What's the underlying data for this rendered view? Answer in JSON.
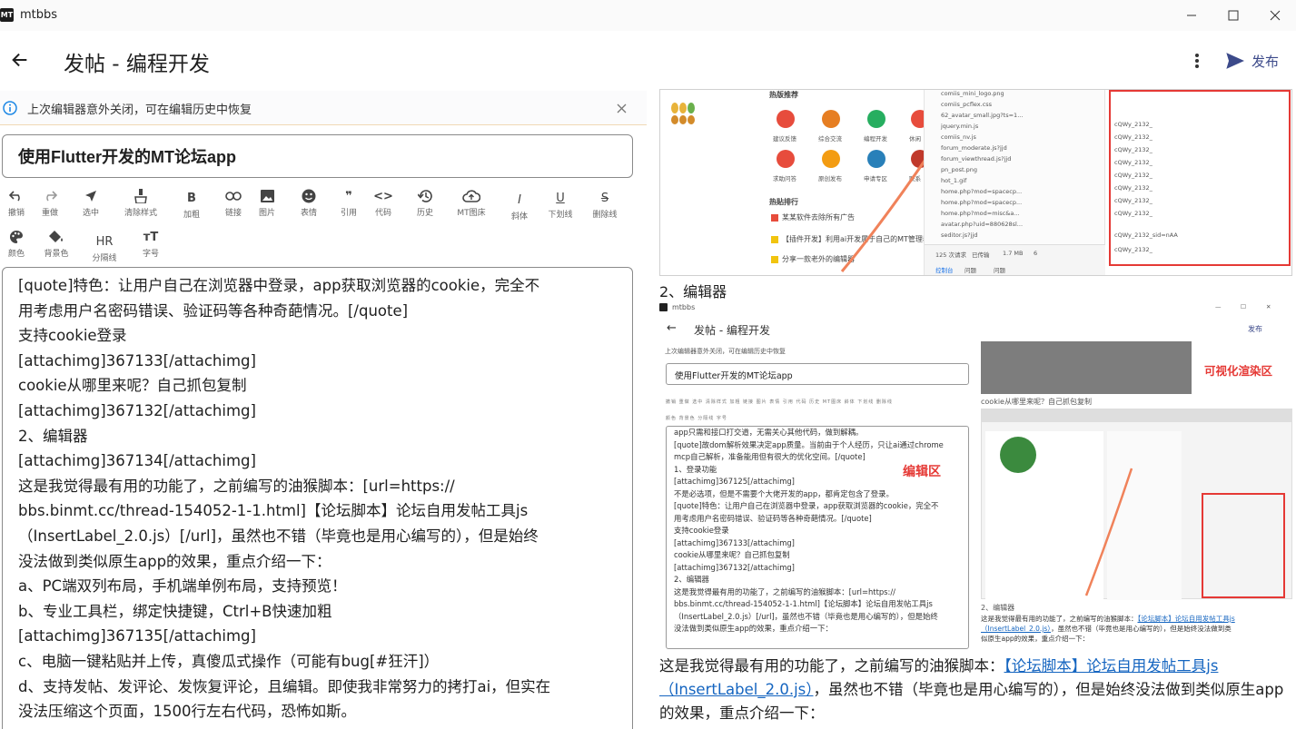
{
  "window": {
    "title": "mtbbs",
    "logo": "MT"
  },
  "appbar": {
    "title": "发帖 - 编程开发",
    "publish_label": "发布"
  },
  "notice": {
    "text": "上次编辑器意外关闭，可在编辑历史中恢复"
  },
  "title_input": {
    "value": "使用Flutter开发的MT论坛app"
  },
  "toolbar": {
    "row1": [
      {
        "id": "undo",
        "label": "撤销",
        "icon": "undo-icon"
      },
      {
        "id": "redo",
        "label": "重做",
        "icon": "redo-icon"
      },
      {
        "id": "select",
        "label": "选中",
        "icon": "cursor-icon"
      },
      {
        "id": "clear-format",
        "label": "清除样式",
        "icon": "brush-icon"
      },
      {
        "id": "bold",
        "label": "加粗",
        "icon": "bold-icon",
        "glyph": "B"
      },
      {
        "id": "link",
        "label": "链接",
        "icon": "link-icon"
      },
      {
        "id": "image",
        "label": "图片",
        "icon": "image-icon"
      },
      {
        "id": "emoji",
        "label": "表情",
        "icon": "emoji-icon"
      },
      {
        "id": "quote",
        "label": "引用",
        "icon": "quote-icon",
        "glyph": "❞"
      },
      {
        "id": "code",
        "label": "代码",
        "icon": "code-icon",
        "glyph": "<>"
      },
      {
        "id": "history",
        "label": "历史",
        "icon": "history-icon"
      },
      {
        "id": "mt-cloud",
        "label": "MT图床",
        "icon": "cloud-upload-icon"
      },
      {
        "id": "italic",
        "label": "斜体",
        "icon": "italic-icon",
        "glyph": "I"
      },
      {
        "id": "underline",
        "label": "下划线",
        "icon": "underline-icon",
        "glyph": "U"
      },
      {
        "id": "strike",
        "label": "删除线",
        "icon": "strikethrough-icon",
        "glyph": "S"
      }
    ],
    "row2": [
      {
        "id": "color",
        "label": "颜色",
        "icon": "palette-icon"
      },
      {
        "id": "bg-color",
        "label": "背景色",
        "icon": "paint-bucket-icon"
      },
      {
        "id": "hr",
        "label": "分隔线",
        "icon": "hr-icon",
        "glyph": "HR"
      },
      {
        "id": "font-size",
        "label": "字号",
        "icon": "font-size-icon",
        "glyph": "ᴛT"
      }
    ]
  },
  "editor": {
    "lines": [
      "[quote]特色：让用户自己在浏览器中登录，app获取浏览器的cookie，完全不",
      "用考虑用户名密码错误、验证码等各种奇葩情况。[/quote]",
      "支持cookie登录",
      "[attachimg]367133[/attachimg]",
      "cookie从哪里来呢？自己抓包复制",
      "[attachimg]367132[/attachimg]",
      "2、编辑器",
      "[attachimg]367134[/attachimg]",
      "这是我觉得最有用的功能了，之前编写的油猴脚本：[url=https://",
      "bbs.binmt.cc/thread-154052-1-1.html]【论坛脚本】论坛自用发帖工具js",
      "（InsertLabel_2.0.js）[/url]，虽然也不错（毕竟也是用心编写的），但是始终",
      "没法做到类似原生app的效果，重点介绍一下：",
      "a、PC端双列布局，手机端单例布局，支持预览！",
      "b、专业工具栏，绑定快捷键，Ctrl+B快速加粗",
      "[attachimg]367135[/attachimg]",
      "c、电脑一键粘贴并上传，真傻瓜式操作（可能有bug[#狂汗]）",
      "d、支持发帖、发评论、发恢复评论，且编辑。即使我非常努力的拷打ai，但实在",
      "没法压缩这个页面，1500行左右代码，恐怖如斯。"
    ]
  },
  "preview": {
    "shot1": {
      "hot_title": "热版推荐",
      "hot_items": [
        "建议反馈",
        "综合交流",
        "编程开发",
        "休闲",
        "求助问答",
        "原创发布",
        "申请专区",
        "联系"
      ],
      "rank_title": "热贴排行",
      "rank_items": [
        "某某软件去除所有广告",
        "【插件开发】利用ai开发属于自己的MT管理器",
        "分享一款老外的编辑器"
      ],
      "files": [
        "comiis_mini_logo.png",
        "comiis_pcflex.css",
        "62_avatar_small.jpg?ts=1...",
        "jquery.min.js",
        "comiis_nv.js",
        "forum_moderate.js?jjd",
        "forum_viewthread.js?jjd",
        "pn_post.png",
        "hot_1.gif",
        "home.php?mod=spacecp...",
        "home.php?mod=spacecp...",
        "home.php?mod=misc&a...",
        "avatar.php?uid=880628sl...",
        "seditor.js?jjd"
      ],
      "stats": [
        "125 次请求",
        "已传输",
        "1.7 MB",
        "6"
      ],
      "devtools_tabs": [
        "控制台",
        "问题",
        "问题"
      ],
      "cookie_lines": [
        "cQWy_2132_",
        "cQWy_2132_",
        "cQWy_2132_",
        "cQWy_2132_",
        "cQWy_2132_",
        "cQWy_2132_",
        "cQWy_2132_",
        "cQWy_2132_",
        "cQWy_2132_sid=nAA",
        "cQWy_2132_"
      ]
    },
    "caption1": "2、编辑器",
    "shot2": {
      "app_title": "mtbbs",
      "page_title": "发帖 - 编程开发",
      "publish": "发布",
      "notice": "上次编辑器意外关闭，可在编辑历史中恢复",
      "title_value": "使用Flutter开发的MT论坛app",
      "tool_labels": [
        "撤销",
        "重做",
        "选中",
        "清除样式",
        "加粗",
        "链接",
        "图片",
        "表情",
        "引用",
        "代码",
        "历史",
        "MT图床",
        "斜体",
        "下划线",
        "删除线"
      ],
      "tool_labels_2": [
        "颜色",
        "背景色",
        "分隔线",
        "字号"
      ],
      "editor_lines": [
        "app只需和接口打交道，无需关心其他代码，做到解耦。",
        "[quote]故dom解析效果决定app质量。当前由于个人经历，只让ai通过chrome",
        "mcp自己解析，准备能用但有很大的优化空间。[/quote]",
        "1、登录功能",
        "[attachimg]367125[/attachimg]",
        "不是必选项，但是不需要个大佬开发的app，都肯定包含了登录。",
        "[quote]特色：让用户自己在浏览器中登录，app获取浏览器的cookie，完全不",
        "用考虑用户名密码错误、验证码等各种奇葩情况。[/quote]",
        "支持cookie登录",
        "[attachimg]367133[/attachimg]",
        "cookie从哪里来呢？自己抓包复制",
        "[attachimg]367132[/attachimg]",
        "2、编辑器",
        "这是我觉得最有用的功能了，之前编写的油猴脚本：[url=https://",
        "bbs.binmt.cc/thread-154052-1-1.html]【论坛脚本】论坛自用发帖工具js",
        "（InsertLabel_2.0.js）[/url]，虽然也不错（毕竟也是用心编写的），但是始终",
        "没法做到类似原生app的效果，重点介绍一下："
      ],
      "editor_label": "编辑区",
      "render_label": "可视化渲染区",
      "render_caption": "cookie从哪里来呢？自己抓包复制",
      "render_caption2": "2、编辑器",
      "render_para": [
        "这是我觉得最有用的功能了，之前编写的油猴脚本：",
        "【论坛脚本】论坛自用发帖工具js",
        "（InsertLabel_2.0.js）",
        "，虽然也不错（毕竟也是用心编写的），但是始终没法做到类",
        "似原生app的效果，重点介绍一下："
      ]
    },
    "para_prefix": "这是我觉得最有用的功能了，之前编写的油猴脚本：",
    "para_link": "【论坛脚本】论坛自用发帖工具js（InsertLabel_2.0.js）",
    "para_suffix": "，虽然也不错（毕竟也是用心编写的），但是始终没法做到类似原生app的效果，重点介绍一下："
  },
  "colors": {
    "accent": "#3c4a8a",
    "link": "#1565c0",
    "annotation_red": "#e53935",
    "notice_icon": "#1e88e5"
  }
}
